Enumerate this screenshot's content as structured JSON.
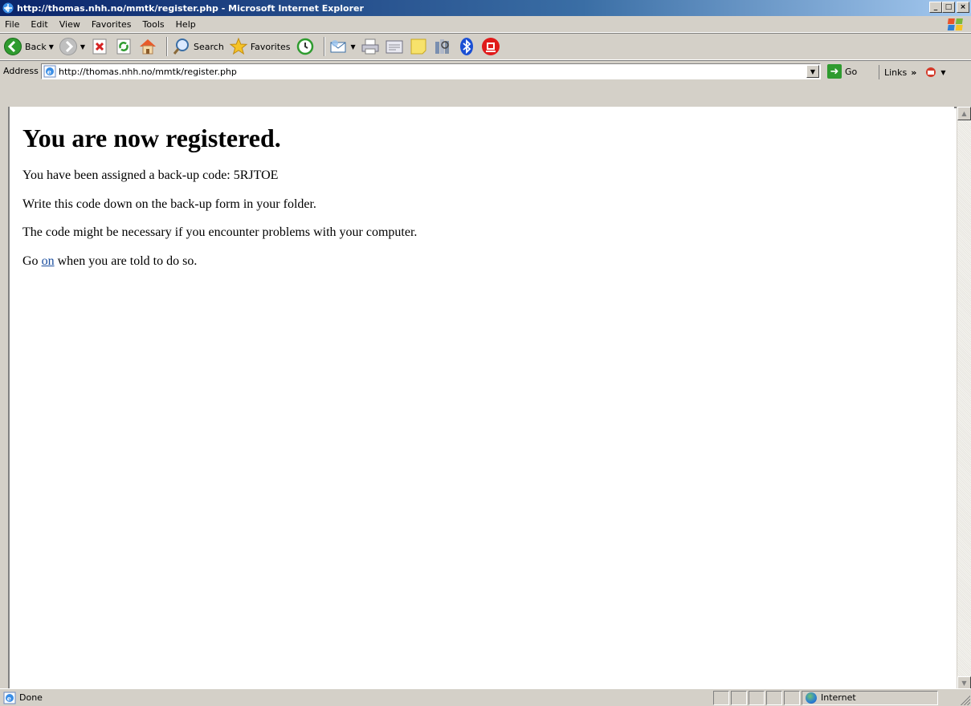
{
  "window": {
    "title": "http://thomas.nhh.no/mmtk/register.php - Microsoft Internet Explorer",
    "min_label": "_",
    "max_label": "□",
    "close_label": "×"
  },
  "menubar": {
    "items": [
      "File",
      "Edit",
      "View",
      "Favorites",
      "Tools",
      "Help"
    ]
  },
  "toolbar": {
    "back_label": "Back",
    "search_label": "Search",
    "favorites_label": "Favorites"
  },
  "address": {
    "label": "Address",
    "url": "http://thomas.nhh.no/mmtk/register.php",
    "go_label": "Go",
    "links_label": "Links"
  },
  "page": {
    "heading": "You are now registered.",
    "line1": "You have been assigned a back-up code: 5RJTOE",
    "line2": "Write this code down on the back-up form in your folder.",
    "line3": "The code might be necessary if you encounter problems with your computer.",
    "line4_prefix": "Go ",
    "line4_link": "on",
    "line4_suffix": " when you are told to do so."
  },
  "status": {
    "text": "Done",
    "zone": "Internet"
  },
  "colors": {
    "titlebar_start": "#0a246a",
    "titlebar_end": "#a6caf0",
    "chrome": "#d4d0c8",
    "link": "#1a4d9e"
  }
}
